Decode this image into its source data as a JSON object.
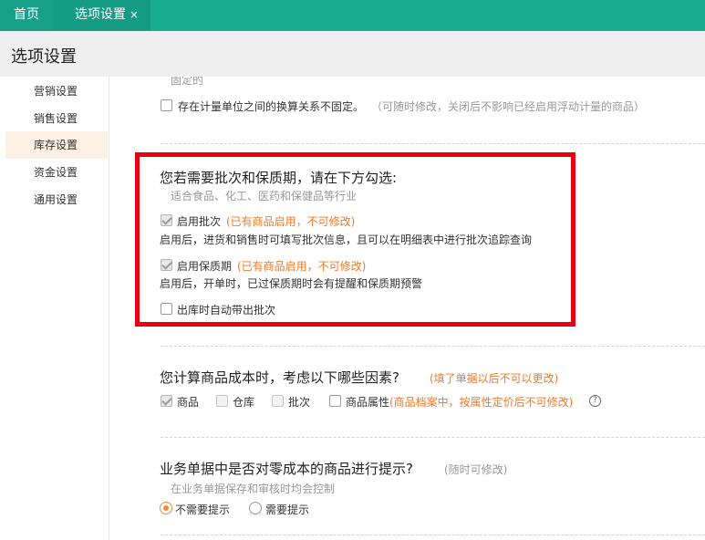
{
  "tabs": {
    "home": "首页",
    "active": "选项设置",
    "close": "×"
  },
  "page_title": "选项设置",
  "sidebar": {
    "items": [
      {
        "label": "营销设置"
      },
      {
        "label": "销售设置"
      },
      {
        "label": "库存设置",
        "active": true
      },
      {
        "label": "资金设置"
      },
      {
        "label": "通用设置"
      }
    ]
  },
  "unit_section": {
    "cut_text": "固定的",
    "checkbox_label": "存在计量单位之间的换算关系不固定。",
    "note": "（可随时修改，关闭后不影响已经启用浮动计量的商品）"
  },
  "batch_section": {
    "title": "您若需要批次和保质期，请在下方勾选:",
    "subtitle": "适合食品、化工、医药和保健品等行业",
    "enable_batch": {
      "label": "启用批次",
      "note": "(已有商品启用，不可修改)",
      "desc": "启用后，进货和销售时可填写批次信息，且可以在明细表中进行批次追踪查询",
      "checked": true
    },
    "enable_shelf": {
      "label": "启用保质期",
      "note": "(已有商品启用，不可修改)",
      "desc": "启用后，开单时，已过保质期时会有提醒和保质期预警",
      "checked": true
    },
    "auto_batch": {
      "label": "出库时自动带出批次",
      "checked": false
    }
  },
  "cost_section": {
    "title": "您计算商品成本时，考虑以下哪些因素?",
    "note": "(填了单据以后不可以更改)",
    "options": [
      {
        "label": "商品",
        "checked": true
      },
      {
        "label": "仓库",
        "checked": false
      },
      {
        "label": "批次",
        "checked": false
      },
      {
        "label": "商品属性",
        "checked": false
      }
    ],
    "attr_note": "(商品档案中，按属性定价后不可修改)",
    "help_icon": "question-circle-icon"
  },
  "zero_cost_section": {
    "title": "业务单据中是否对零成本的商品进行提示?",
    "note": "(随时可修改)",
    "subtitle": "在业务单据保存和审核时均会控制",
    "options": [
      {
        "label": "不需要提示",
        "selected": true
      },
      {
        "label": "需要提示",
        "selected": false
      }
    ]
  },
  "colors": {
    "topbar": "#1aab93",
    "accent_orange": "#f07a2a",
    "highlight_box": "#e60012",
    "sidebar_active": "#fdf0e4"
  }
}
